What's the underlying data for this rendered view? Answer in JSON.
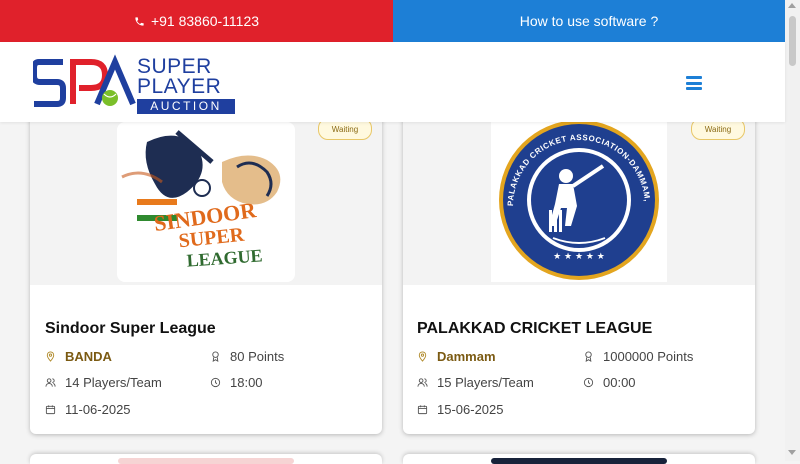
{
  "topbar": {
    "phone_icon": "phone-icon",
    "phone": "+91 83860-11123",
    "help_link": "How to use software ?",
    "colors": {
      "left": "#e0212b",
      "right": "#1d7fd6"
    }
  },
  "header": {
    "logo_initials": "SPA",
    "logo_line1": "SUPER",
    "logo_line2": "PLAYER",
    "logo_line3": "AUCTION",
    "menu_icon": "hamburger-menu-icon"
  },
  "cards": [
    {
      "badge": "Waiting",
      "image_text_1": "SINDOOR",
      "image_text_2": "SUPER",
      "image_text_3": "LEAGUE",
      "title": "Sindoor Super League",
      "location": "BANDA",
      "points": "80 Points",
      "players": "14 Players/Team",
      "time": "18:00",
      "date": "11-06-2025"
    },
    {
      "badge": "Waiting",
      "image_text_1": "PALAKKAD CRICKET ASSOCIATION-DAMMAM, SAUDI ARABIA",
      "title": "PALAKKAD CRICKET LEAGUE",
      "location": "Dammam",
      "points": "1000000 Points",
      "players": "15 Players/Team",
      "time": "00:00",
      "date": "15-06-2025"
    }
  ]
}
